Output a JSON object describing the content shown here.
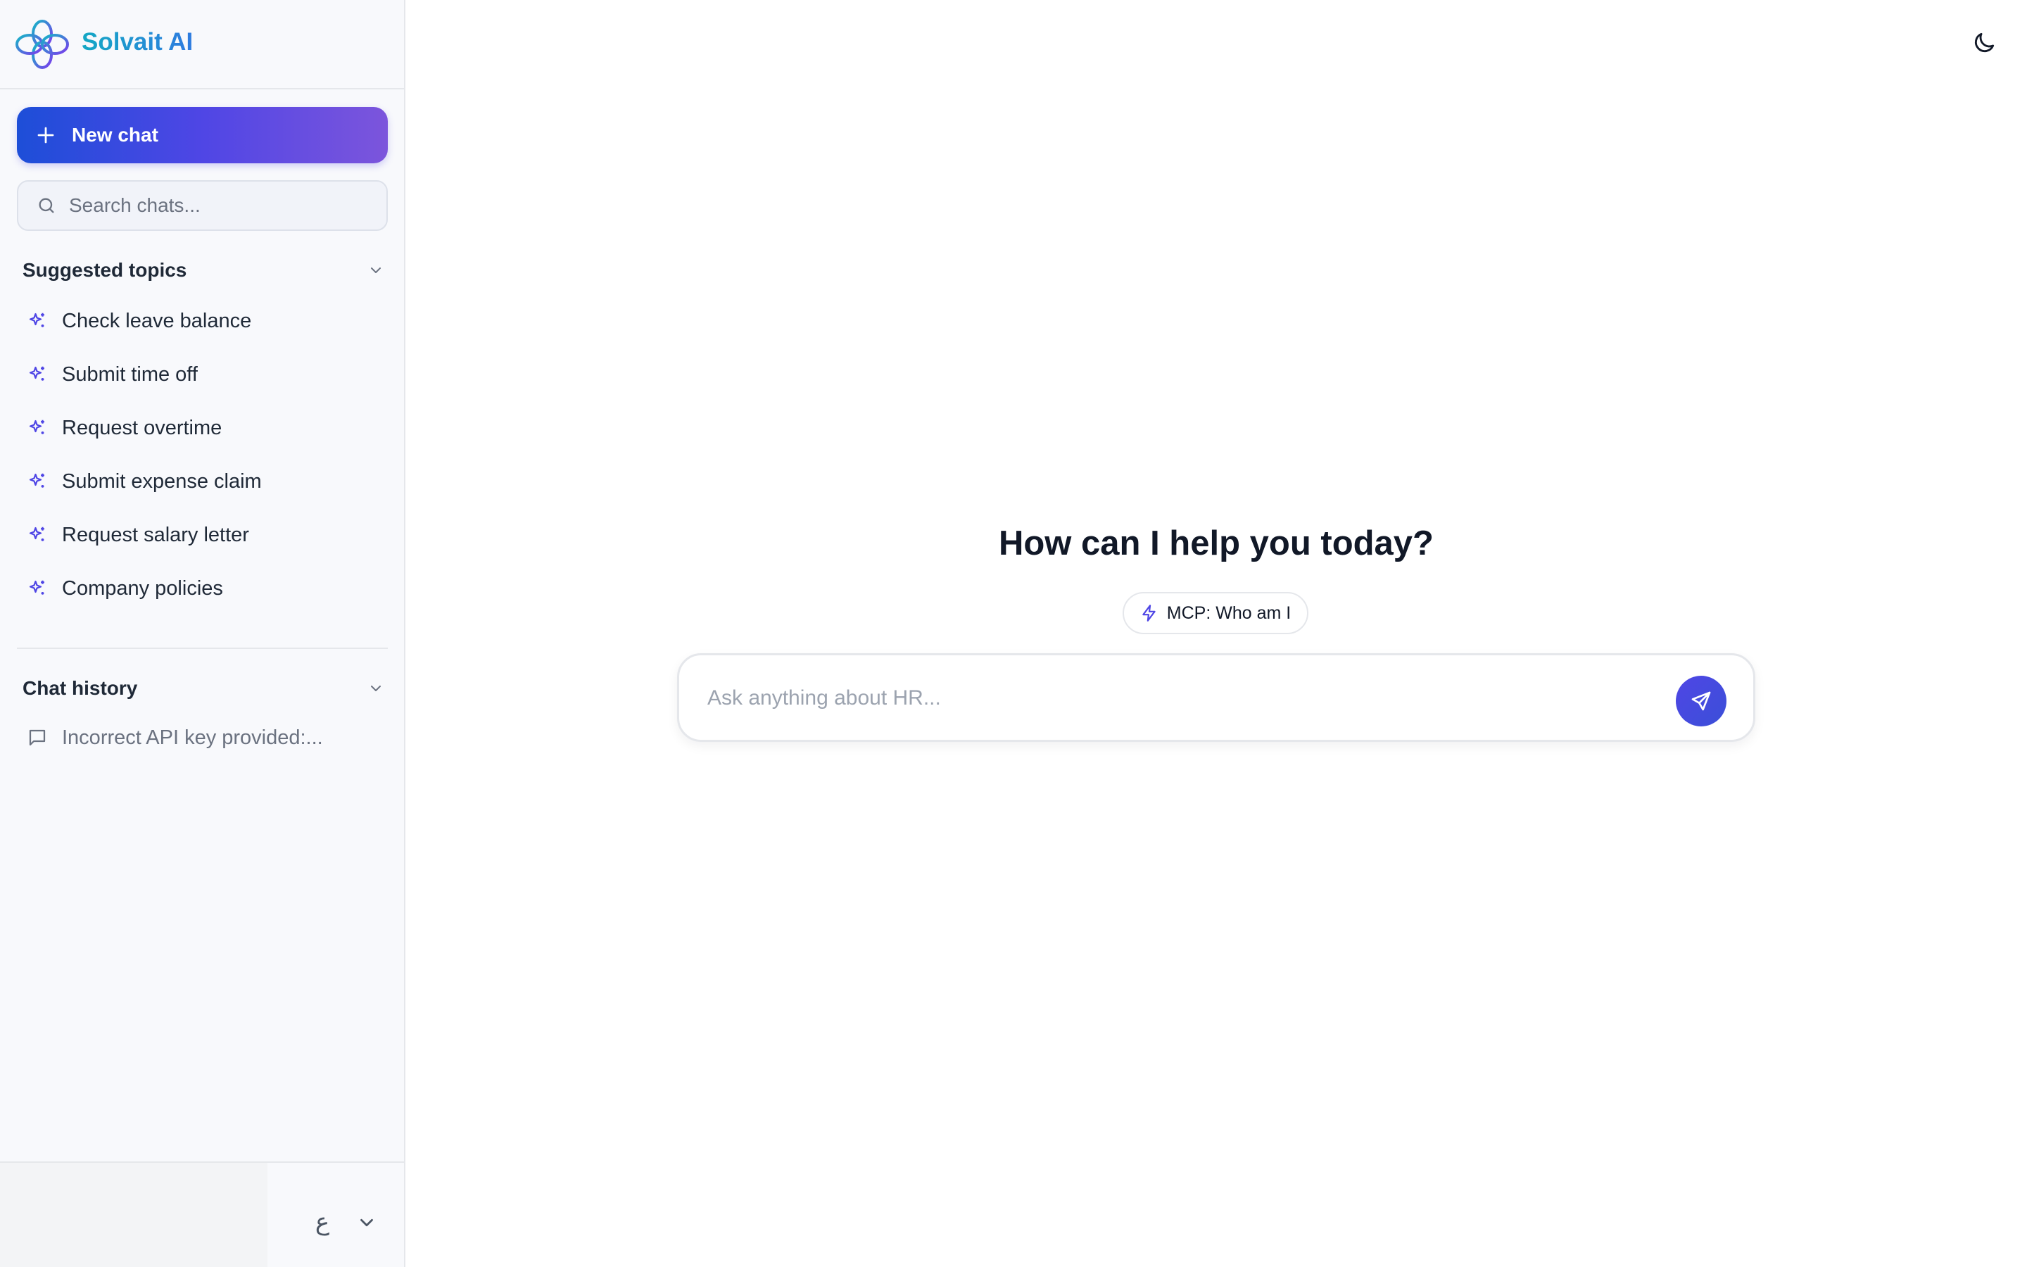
{
  "app": {
    "name": "Solvait AI"
  },
  "sidebar": {
    "new_chat_label": "New chat",
    "search_placeholder": "Search chats...",
    "suggested": {
      "title": "Suggested topics",
      "items": [
        {
          "label": "Check leave balance"
        },
        {
          "label": "Submit time off"
        },
        {
          "label": "Request overtime"
        },
        {
          "label": "Submit expense claim"
        },
        {
          "label": "Request salary letter"
        },
        {
          "label": "Company policies"
        }
      ]
    },
    "history": {
      "title": "Chat history",
      "items": [
        {
          "label": "Incorrect API key provided:..."
        }
      ]
    },
    "footer": {
      "language_glyph": "ع"
    }
  },
  "main": {
    "headline": "How can I help you today?",
    "quick_action": "MCP: Who am I",
    "composer_placeholder": "Ask anything about HR..."
  },
  "icons": {
    "new_chat": "plus-icon",
    "search": "search-icon",
    "collapse": "chevron-down-icon",
    "topic": "sparkles-icon",
    "history": "message-square-icon",
    "theme": "moon-icon",
    "quick_action": "zap-icon",
    "send": "send-icon"
  },
  "colors": {
    "brand_gradient_start": "#1d4ed8",
    "brand_gradient_end": "#7c55dc",
    "accent": "#4f46e5",
    "sidebar_bg": "#f8f9fc"
  }
}
